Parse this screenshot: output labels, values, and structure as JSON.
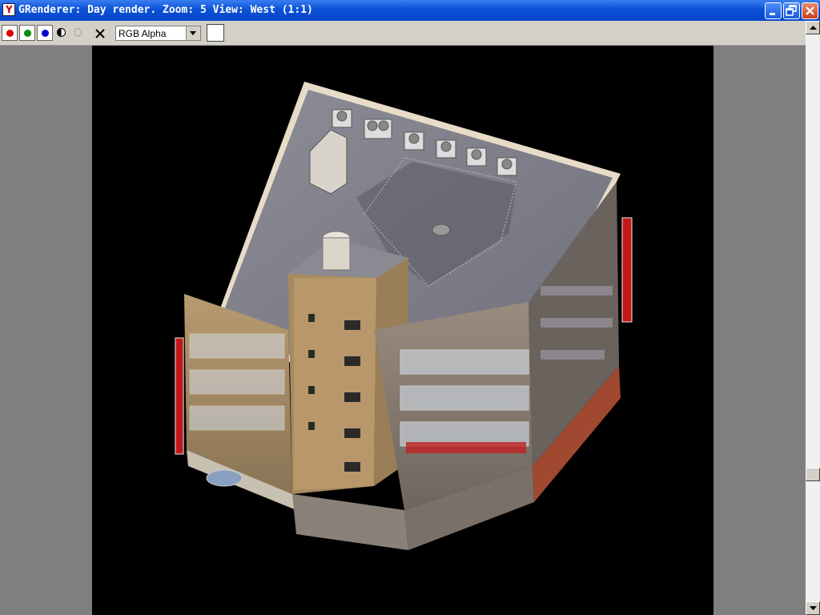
{
  "window": {
    "title": "GRenderer: Day render. Zoom: 5 View: West (1:1)",
    "app_icon": "grenderer-app-icon",
    "controls": [
      "minimize-icon",
      "restore-icon",
      "close-icon"
    ]
  },
  "toolbar": {
    "channels": [
      {
        "name": "red-channel",
        "color": "#e00000"
      },
      {
        "name": "green-channel",
        "color": "#009000"
      },
      {
        "name": "blue-channel",
        "color": "#0000d0"
      }
    ],
    "contrast_icon": "contrast-icon",
    "dim_icon": "brightness-icon",
    "clear_icon": "close-x-icon",
    "display_mode": {
      "selected": "RGB Alpha"
    },
    "background_swatch": "#ffffff"
  },
  "canvas": {
    "background": "#000000",
    "content": "isometric building render"
  },
  "scrollbar": {
    "thumb_position": 0.75
  }
}
